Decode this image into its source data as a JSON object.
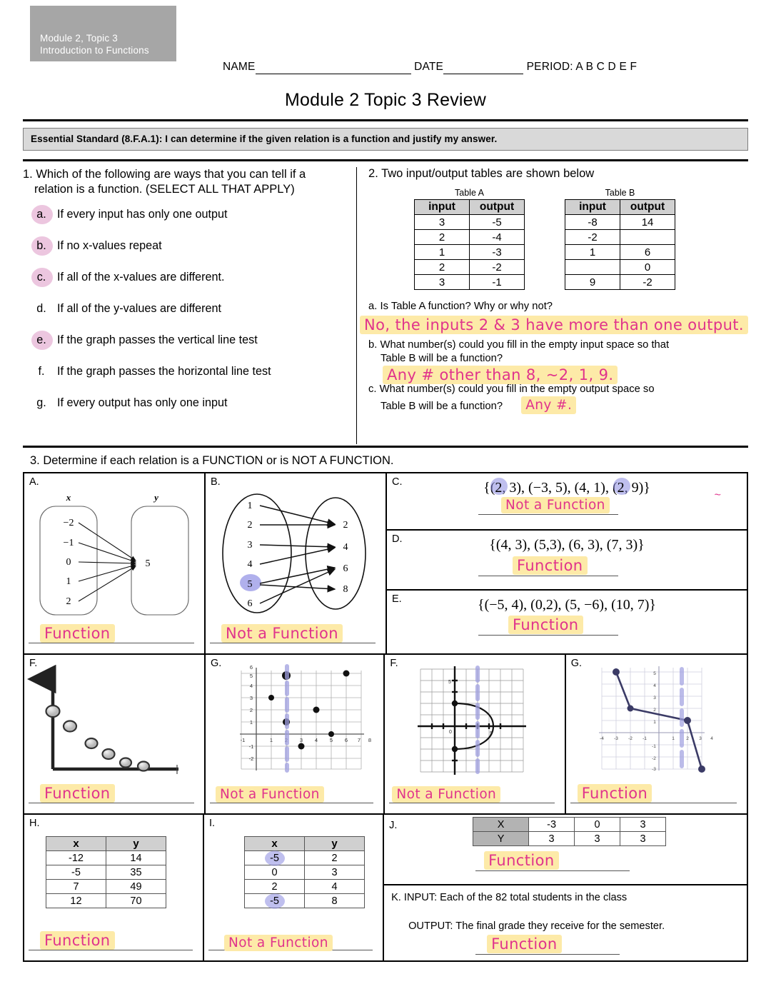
{
  "header": {
    "module_box_line1": "Module 2, Topic 3",
    "module_box_line2": "Introduction to Functions",
    "name_label": "NAME",
    "date_label": "DATE",
    "period_label": "PERIOD: A B C D E F",
    "title": "Module 2 Topic 3 Review",
    "standard": "Essential Standard (8.F.A.1):  I can determine if the given relation is a function and justify my answer."
  },
  "q1": {
    "prompt_line1": "1. Which of the following are ways that you can tell if a",
    "prompt_line2": "relation is a function.  (SELECT ALL THAT APPLY)",
    "options": [
      {
        "letter": "a.",
        "text": "If every input has only one output",
        "circled": true
      },
      {
        "letter": "b.",
        "text": "If no x-values repeat",
        "circled": true
      },
      {
        "letter": "c.",
        "text": "If all of the x-values are different.",
        "circled": true
      },
      {
        "letter": "d.",
        "text": "If all of the y-values are different",
        "circled": false
      },
      {
        "letter": "e.",
        "text": "If the graph passes the vertical line test",
        "circled": true
      },
      {
        "letter": "f.",
        "text": "If the graph passes the horizontal line test",
        "circled": false
      },
      {
        "letter": "g.",
        "text": "If every output has only one input",
        "circled": false
      }
    ]
  },
  "q2": {
    "prompt": "2. Two input/output tables are shown below",
    "table_a": {
      "caption": "Table A",
      "headers": [
        "input",
        "output"
      ],
      "rows": [
        [
          "3",
          "-5"
        ],
        [
          "2",
          "-4"
        ],
        [
          "1",
          "-3"
        ],
        [
          "2",
          "-2"
        ],
        [
          "3",
          "-1"
        ]
      ]
    },
    "table_b": {
      "caption": "Table B",
      "headers": [
        "input",
        "output"
      ],
      "rows": [
        [
          "-8",
          "14"
        ],
        [
          "-2",
          ""
        ],
        [
          "1",
          "6"
        ],
        [
          "",
          "0"
        ],
        [
          "9",
          "-2"
        ]
      ]
    },
    "part_a": "a.  Is Table A function? Why or why not?",
    "answer_a": "No, the inputs 2 & 3 have more than one output.",
    "part_b_line1": "b.  What number(s) could you fill in the empty input space so that",
    "part_b_line2": "Table B will be a function?",
    "answer_b": "Any # other than 8, ~2, 1, 9.",
    "part_c_line1": "c. What number(s) could you fill in the empty output space so",
    "part_c_line2": "Table B will be a function?",
    "answer_c": "Any #."
  },
  "q3": {
    "prompt": "3.  Determine if each relation is a FUNCTION or is NOT A FUNCTION.",
    "panels": {
      "A": {
        "label": "A.",
        "type": "mapping",
        "x_label": "x",
        "y_label": "y",
        "inputs": [
          "−2",
          "−1",
          "0",
          "1",
          "2"
        ],
        "outputs": [
          "5"
        ],
        "answer": "Function"
      },
      "B": {
        "label": "B.",
        "type": "mapping",
        "inputs": [
          "1",
          "2",
          "3",
          "4",
          "5",
          "6"
        ],
        "outputs": [
          "2",
          "4",
          "6",
          "8"
        ],
        "circled_input": "5",
        "answer": "Not a Function"
      },
      "C": {
        "label": "C.",
        "type": "set",
        "pairs": "{(2, 3), (−3, 5), (4, 1), (2, 9)}",
        "circled_values": [
          "2",
          "2"
        ],
        "answer": "Not a Function"
      },
      "D": {
        "label": "D.",
        "type": "set",
        "pairs": "{(4, 3), (5,3), (6, 3), (7, 3)}",
        "answer": "Function"
      },
      "E": {
        "label": "E.",
        "type": "set",
        "pairs": "{(−5, 4), (0,2), (5, −6), (10, 7)}",
        "answer": "Function"
      },
      "F1": {
        "label": "F.",
        "type": "scatter-plain",
        "answer": "Function"
      },
      "G1": {
        "label": "G.",
        "type": "scatter-grid",
        "answer": "Not a Function"
      },
      "F2": {
        "label": "F.",
        "type": "parabola",
        "answer": "Not a Function"
      },
      "G2": {
        "label": "G.",
        "type": "piecewise",
        "answer": "Function"
      },
      "H": {
        "label": "H.",
        "type": "table",
        "headers": [
          "x",
          "y"
        ],
        "rows": [
          [
            "-12",
            "14"
          ],
          [
            "-5",
            "35"
          ],
          [
            "7",
            "49"
          ],
          [
            "12",
            "70"
          ]
        ],
        "answer": "Function"
      },
      "I": {
        "label": "I.",
        "type": "table",
        "headers": [
          "x",
          "y"
        ],
        "rows": [
          [
            "-5",
            "2"
          ],
          [
            "0",
            "3"
          ],
          [
            "2",
            "4"
          ],
          [
            "-5",
            "8"
          ]
        ],
        "circled_cells": [
          [
            0,
            0
          ],
          [
            3,
            0
          ]
        ],
        "answer": "Not a Function"
      },
      "J": {
        "label": "J.",
        "type": "htable",
        "row_x": [
          "X",
          "-3",
          "0",
          "3"
        ],
        "row_y": [
          "Y",
          "3",
          "3",
          "3"
        ],
        "answer": "Function"
      },
      "K": {
        "label": "K.",
        "type": "text",
        "input_line": "K.  INPUT: Each of the 82 total students in the class",
        "output_line": "OUTPUT: The final grade they receive for the semester.",
        "answer": "Function"
      }
    }
  },
  "chart_data": [
    {
      "type": "scatter",
      "id": "panel-F1",
      "title": "",
      "x": [
        0,
        1,
        2,
        3,
        4,
        5
      ],
      "y": [
        6,
        4.6,
        3.1,
        2.1,
        1.3,
        0.9
      ],
      "grid": false,
      "xlabel": "",
      "ylabel": ""
    },
    {
      "type": "scatter",
      "id": "panel-G1",
      "x": [
        1,
        2,
        2,
        3,
        4,
        5,
        6
      ],
      "y": [
        3,
        5,
        1,
        -1,
        2,
        0,
        6
      ],
      "xlim": [
        -1,
        8
      ],
      "ylim": [
        -2,
        6
      ],
      "grid": true,
      "annotation": "vertical line test at x = 2",
      "xticks": [
        "-1",
        "1",
        "2",
        "3",
        "4",
        "5",
        "6",
        "7",
        "8"
      ],
      "yticks": [
        "-2",
        "-1",
        "1",
        "2",
        "3",
        "4",
        "5",
        "6"
      ]
    },
    {
      "type": "line",
      "id": "panel-F2",
      "annotation": "sideways parabola, vertex (3,0), endpoints (0,2) and (0,-2)",
      "xlim": [
        -5,
        5
      ],
      "ylim": [
        -5,
        5
      ],
      "grid": true
    },
    {
      "type": "line",
      "id": "panel-G2",
      "x": [
        -3,
        -2,
        2,
        4
      ],
      "y": [
        5,
        2,
        1,
        -3
      ],
      "xlim": [
        -4,
        4
      ],
      "ylim": [
        -3,
        5
      ],
      "grid": true,
      "xticks": [
        "-4",
        "-3",
        "-2",
        "-1",
        "1",
        "2",
        "3",
        "4"
      ],
      "yticks": [
        "-3",
        "-2",
        "-1",
        "1",
        "2",
        "3",
        "4",
        "5"
      ]
    }
  ]
}
